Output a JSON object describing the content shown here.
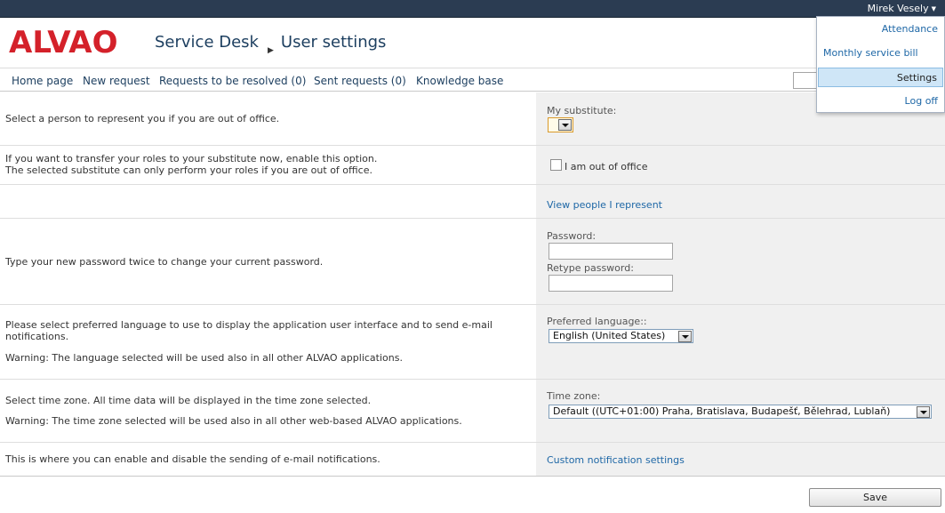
{
  "user": {
    "name": "Mirek Vesely",
    "menu": [
      "Attendance",
      "Monthly service bill",
      "Settings",
      "Log off"
    ],
    "active_menu": "Settings"
  },
  "header": {
    "logo": "ALVAO",
    "crumb_app": "Service Desk",
    "crumb_page": "User settings"
  },
  "nav": {
    "items": [
      "Home page",
      "New request",
      "Requests to be resolved (0)",
      "Sent requests (0)",
      "Knowledge base"
    ]
  },
  "settings": {
    "substitute": {
      "description": "Select a person to represent you if you are out of office.",
      "label": "My substitute:"
    },
    "out_of_office": {
      "description_line1": "If you want to transfer your roles to your substitute now, enable this option.",
      "description_line2": "The selected substitute can only perform your roles if you are out of office.",
      "checkbox_label": "I am out of office"
    },
    "represent": {
      "link": "View people I represent"
    },
    "password": {
      "description": "Type your new password twice to change your current password.",
      "label": "Password:",
      "retype_label": "Retype password:"
    },
    "language": {
      "description_line1": "Please select preferred language to use to display the application user interface and to send e-mail",
      "description_line2": "notifications.",
      "warning": "Warning: The language selected will be used also in all other ALVAO applications.",
      "label": "Preferred language::",
      "value": "English (United States)"
    },
    "timezone": {
      "description": "Select time zone. All time data will be displayed in the time zone selected.",
      "warning": "Warning: The time zone selected will be used also in all other web-based ALVAO applications.",
      "label": "Time zone:",
      "value": "Default ((UTC+01:00) Praha, Bratislava, Budapešť, Bělehrad, Lublaň)"
    },
    "notifications": {
      "description": "This is where you can enable and disable the sending of e-mail notifications.",
      "link": "Custom notification settings"
    }
  },
  "save_label": "Save",
  "colors": {
    "topbar": "#2b3c52",
    "logo": "#d4212a",
    "link": "#1e67a6",
    "control_panel": "#f0f0f0"
  },
  "icons": [
    "caret-down-icon",
    "dropdown-arrow-icon",
    "breadcrumb-arrow-icon"
  ]
}
